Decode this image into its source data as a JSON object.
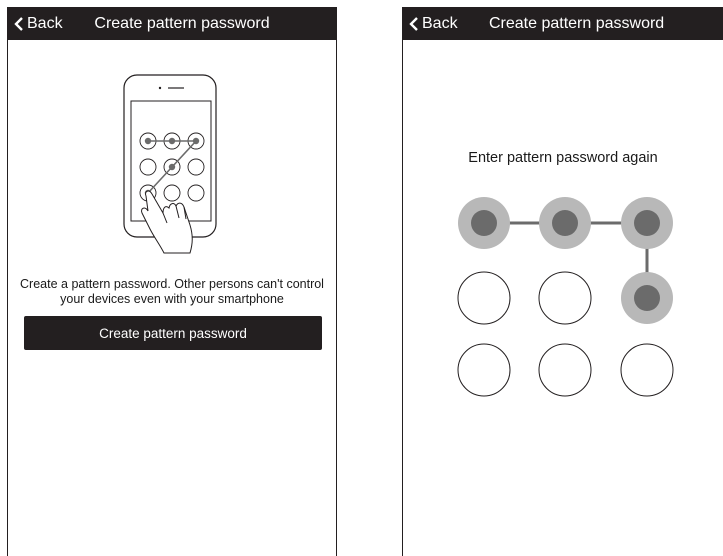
{
  "left_screen": {
    "back_label": "Back",
    "title": "Create pattern password",
    "description_line1": "Create a pattern password. Other persons can't control",
    "description_line2": "your devices even with your smartphone",
    "create_button_label": "Create pattern password"
  },
  "right_screen": {
    "back_label": "Back",
    "title": "Create pattern password",
    "prompt": "Enter pattern password again",
    "pattern": {
      "selected_dots": [
        1,
        2,
        3,
        6
      ],
      "path_order": [
        1,
        2,
        3,
        6
      ]
    }
  },
  "colors": {
    "navbar": "#231f20",
    "dot_halo": "#b8b8b8",
    "dot_core": "#6b6b6b",
    "line": "#6b6b6b"
  },
  "icons": [
    "chevron-left-icon",
    "phone-illustration",
    "hand-icon"
  ]
}
